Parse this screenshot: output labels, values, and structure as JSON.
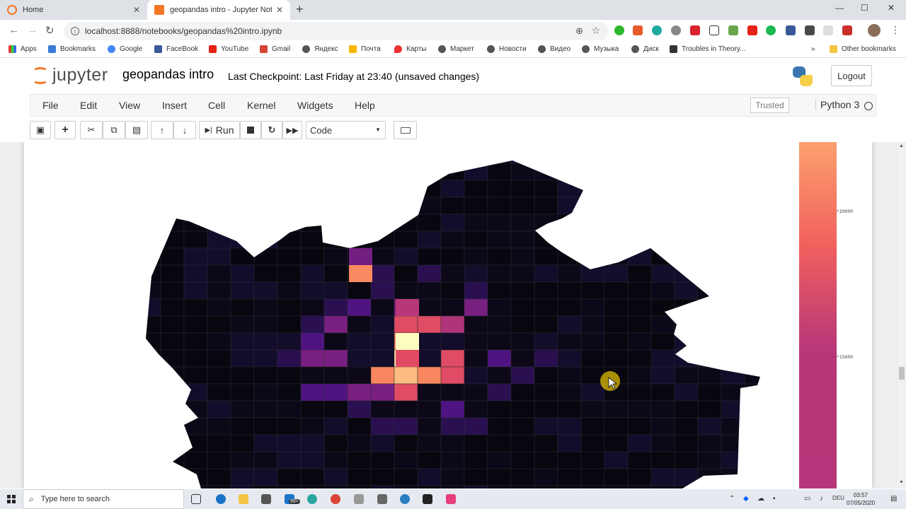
{
  "browser": {
    "tabs": [
      {
        "label": "Home",
        "active": false
      },
      {
        "label": "geopandas intro - Jupyter Noteb",
        "active": true
      }
    ],
    "url": "localhost:8888/notebooks/geopandas%20intro.ipynb",
    "bookmarks": [
      "Apps",
      "Bookmarks",
      "Google",
      "FaceBook",
      "YouTube",
      "Gmail",
      "Яндекс",
      "Почта",
      "Карты",
      "Маркет",
      "Новости",
      "Видео",
      "Музыка",
      "Диск",
      "Troubles in Theory...",
      "Other bookmarks"
    ],
    "overflow": "»"
  },
  "jupyter": {
    "brand": "jupyter",
    "notebook_title": "geopandas intro",
    "checkpoint": "Last Checkpoint: Last Friday at 23:40",
    "unsaved": "(unsaved changes)",
    "logout_label": "Logout",
    "menu": [
      "File",
      "Edit",
      "View",
      "Insert",
      "Cell",
      "Kernel",
      "Widgets",
      "Help"
    ],
    "trusted_label": "Trusted",
    "kernel_name": "Python 3",
    "run_label": "Run",
    "cell_type": "Code"
  },
  "chart_data": {
    "type": "heatmap",
    "colormap": "magma",
    "colorbar_ticks": [
      "20000",
      "15000"
    ]
  },
  "taskbar": {
    "search_placeholder": "Type here to search",
    "badge": "99+",
    "language": "DEU",
    "time": "03:57",
    "date": "07/05/2020"
  }
}
